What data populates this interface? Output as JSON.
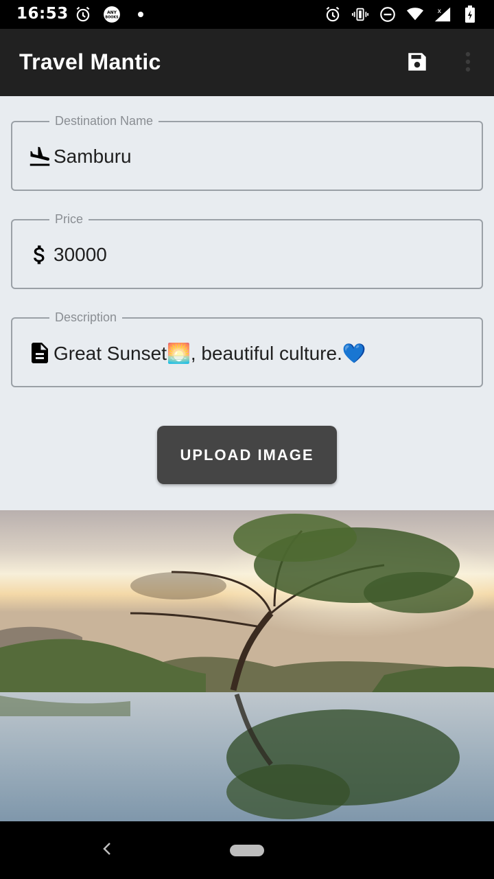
{
  "status_bar": {
    "time": "16:53",
    "left_icons": [
      "alarm-icon",
      "anybooks-app-icon",
      "notification-dot-icon"
    ],
    "anybooks_text": "ANY BOOKS",
    "right_icons": [
      "alarm-icon",
      "vibrate-icon",
      "do-not-disturb-icon",
      "wifi-icon",
      "signal-icon",
      "battery-charging-icon"
    ]
  },
  "app_bar": {
    "title": "Travel Mantic",
    "actions": [
      "save-icon",
      "more-vert-icon"
    ]
  },
  "form": {
    "destination": {
      "label": "Destination Name",
      "value": "Samburu",
      "icon": "flight-land-icon"
    },
    "price": {
      "label": "Price",
      "value": "30000",
      "icon": "dollar-icon"
    },
    "description": {
      "label": "Description",
      "value": "Great Sunset🌅, beautiful culture.💙",
      "icon": "document-icon"
    },
    "upload_label": "UPLOAD IMAGE"
  },
  "image": {
    "description_icon": "photo-icon"
  },
  "nav_bar": {
    "buttons": [
      "back-icon",
      "home-pill"
    ]
  }
}
